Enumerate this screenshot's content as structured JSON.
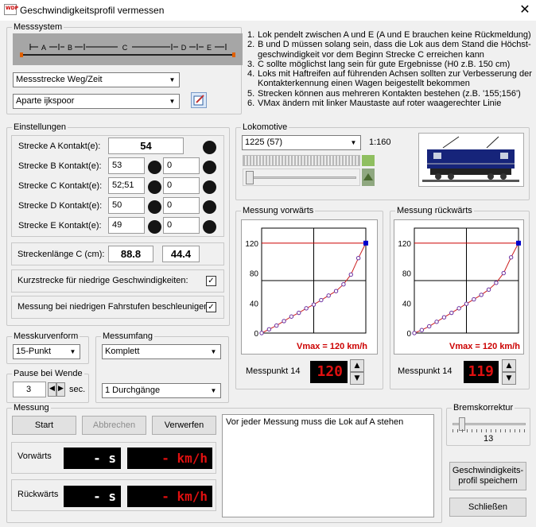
{
  "window": {
    "title": "Geschwindigkeitsprofil vermessen",
    "icon_text": "WDP",
    "close_glyph": "✕"
  },
  "messsystem": {
    "label": "Messsystem",
    "track_labels": [
      "A",
      "B",
      "C",
      "D",
      "E"
    ],
    "combo_mode": "Messstrecke Weg/Zeit",
    "combo_track": "Aparte ijkspoor"
  },
  "instructions": [
    {
      "n": "1.",
      "text": "Lok pendelt zwischen A und E (A und E brauchen keine Rückmeldung)"
    },
    {
      "n": "2.",
      "text": "B und D müssen solang sein, dass die Lok aus dem Stand die Höchst-geschwindigkeit vor dem Beginn Strecke C erreichen kann"
    },
    {
      "n": "3.",
      "text": "C sollte möglichst lang sein für gute Ergebnisse (H0 z.B. 150 cm)"
    },
    {
      "n": "4.",
      "text": "Loks mit Haftreifen auf führenden Achsen sollten zur Verbesserung der Kontakterkennung einen Wagen beigestellt bekommen"
    },
    {
      "n": "5.",
      "text": "Strecken können aus mehreren Kontakten bestehen (z.B. '155;156')"
    },
    {
      "n": "6.",
      "text": "VMax ändern mit linker Maustaste auf roter waagerechter Linie"
    }
  ],
  "einstellungen": {
    "label": "Einstellungen",
    "rows": [
      {
        "label": "Strecke A Kontakt(e):",
        "value": "54"
      },
      {
        "label": "Strecke B Kontakt(e):",
        "value": "53",
        "value2": "0"
      },
      {
        "label": "Strecke C Kontakt(e):",
        "value": "52;51",
        "value2": "0"
      },
      {
        "label": "Strecke D Kontakt(e):",
        "value": "50",
        "value2": "0"
      },
      {
        "label": "Strecke E Kontakt(e):",
        "value": "49",
        "value2": "0"
      }
    ],
    "streckenlaenge_label": "Streckenlänge C (cm):",
    "streckenlaenge_value": "88.8",
    "streckenlaenge_value2": "44.4",
    "kurzstrecke_label": "Kurzstrecke für niedrige Geschwindigkeiten:",
    "beschleunigen_label": "Messung bei niedrigen Fahrstufen beschleunigen:",
    "check_glyph": "✓"
  },
  "lokomotive": {
    "label": "Lokomotive",
    "selected": "1225 (57)",
    "scale": "1:160"
  },
  "vorwaerts": {
    "label": "Messung vorwärts",
    "vmax_text": "Vmax = 120 km/h",
    "messpunkt_label": "Messpunkt 14",
    "value": "120"
  },
  "rueckwaerts": {
    "label": "Messung rückwärts",
    "vmax_text": "Vmax = 120 km/h",
    "messpunkt_label": "Messpunkt 14",
    "value": "119"
  },
  "chart_data": [
    {
      "type": "line",
      "title": "Messung vorwärts",
      "y_ticks": [
        "120",
        "80",
        "40",
        "0"
      ],
      "ylim": [
        0,
        140
      ],
      "vmax": 120,
      "x": [
        0,
        1,
        2,
        3,
        4,
        5,
        6,
        7,
        8,
        9,
        10,
        11,
        12,
        13,
        14
      ],
      "values": [
        0,
        5,
        10,
        16,
        22,
        27,
        33,
        38,
        44,
        50,
        56,
        65,
        78,
        100,
        120
      ],
      "grid": true
    },
    {
      "type": "line",
      "title": "Messung rückwärts",
      "y_ticks": [
        "120",
        "80",
        "40",
        "0"
      ],
      "ylim": [
        0,
        140
      ],
      "vmax": 120,
      "x": [
        0,
        1,
        2,
        3,
        4,
        5,
        6,
        7,
        8,
        9,
        10,
        11,
        12,
        13,
        14
      ],
      "values": [
        0,
        4,
        9,
        15,
        21,
        27,
        33,
        39,
        45,
        51,
        58,
        67,
        80,
        101,
        120
      ],
      "grid": true
    }
  ],
  "messkurvenform": {
    "label": "Messkurvenform",
    "value": "15-Punkt"
  },
  "messumfang": {
    "label": "Messumfang",
    "value": "Komplett",
    "durchgaenge": "1 Durchgänge"
  },
  "pause": {
    "label": "Pause bei Wende",
    "value": "3",
    "unit": "sec."
  },
  "messung": {
    "label": "Messung",
    "start": "Start",
    "abbrechen": "Abbrechen",
    "verwerfen": "Verwerfen",
    "vorwaerts_label": "Vorwärts",
    "rueckwaerts_label": "Rückwärts",
    "time_display": "- s",
    "speed_display": "- km/h",
    "message": "Vor jeder Messung muss die Lok auf A stehen"
  },
  "bremskorrektur": {
    "label": "Bremskorrektur",
    "value": "13"
  },
  "buttons": {
    "speichern": "Geschwindigkeits-profil speichern",
    "schliessen": "Schließen"
  },
  "colors": {
    "red_line": "#cc0000",
    "curve": "#6a2fa0",
    "endpoint": "#0000cc",
    "led_red": "#e01010"
  }
}
